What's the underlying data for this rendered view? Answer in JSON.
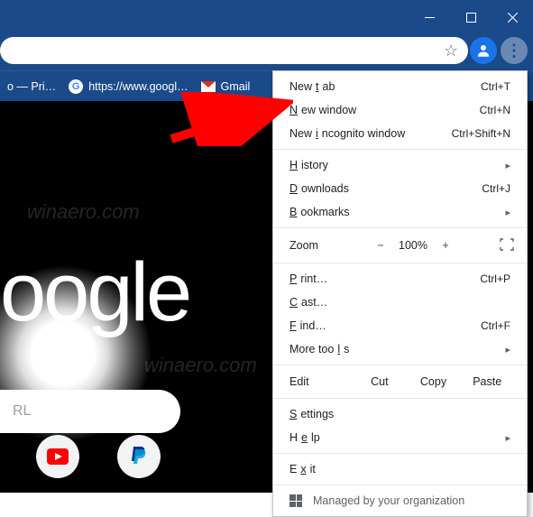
{
  "window": {
    "minimize": "─",
    "maximize": "☐",
    "close": "✕"
  },
  "toolbar": {
    "star": "☆",
    "more": "⋮"
  },
  "bookmarks": {
    "items": [
      {
        "label": "o — Pri…"
      },
      {
        "label": "https://www.googl…"
      },
      {
        "label": "Gmail"
      }
    ]
  },
  "page": {
    "logo": "oogle",
    "search_placeholder": "RL",
    "watermark": "winaero.com"
  },
  "menu": {
    "new_tab": {
      "label_pre": "New ",
      "label_ul": "t",
      "label_post": "ab",
      "shortcut": "Ctrl+T"
    },
    "new_window": {
      "label_ul": "N",
      "label_post": "ew window",
      "shortcut": "Ctrl+N"
    },
    "incognito": {
      "label_pre": "New ",
      "label_ul": "i",
      "label_post": "ncognito window",
      "shortcut": "Ctrl+Shift+N"
    },
    "history": {
      "label_ul": "H",
      "label_post": "istory"
    },
    "downloads": {
      "label_ul": "D",
      "label_post": "ownloads",
      "shortcut": "Ctrl+J"
    },
    "bookmarks": {
      "label_ul": "B",
      "label_post": "ookmarks"
    },
    "zoom": {
      "label": "Zoom",
      "minus": "−",
      "value": "100%",
      "plus": "+"
    },
    "print": {
      "label_ul": "P",
      "label_post": "rint…",
      "shortcut": "Ctrl+P"
    },
    "cast": {
      "label_ul": "C",
      "label_post": "ast…"
    },
    "find": {
      "label_ul": "F",
      "label_post": "ind…",
      "shortcut": "Ctrl+F"
    },
    "more_tools": {
      "label_pre": "More too",
      "label_ul": "l",
      "label_post": "s"
    },
    "edit": {
      "label_ul": "E",
      "label_post": "dit",
      "cut": "Cut",
      "copy": "Copy",
      "paste": "Paste"
    },
    "settings": {
      "label_ul": "S",
      "label_post": "ettings"
    },
    "help": {
      "label_pre": "H",
      "label_ul": "e",
      "label_post": "lp"
    },
    "exit": {
      "label_pre": "E",
      "label_ul": "x",
      "label_post": "it"
    },
    "managed": {
      "label": "Managed by your organization"
    },
    "chevron": "▸"
  }
}
